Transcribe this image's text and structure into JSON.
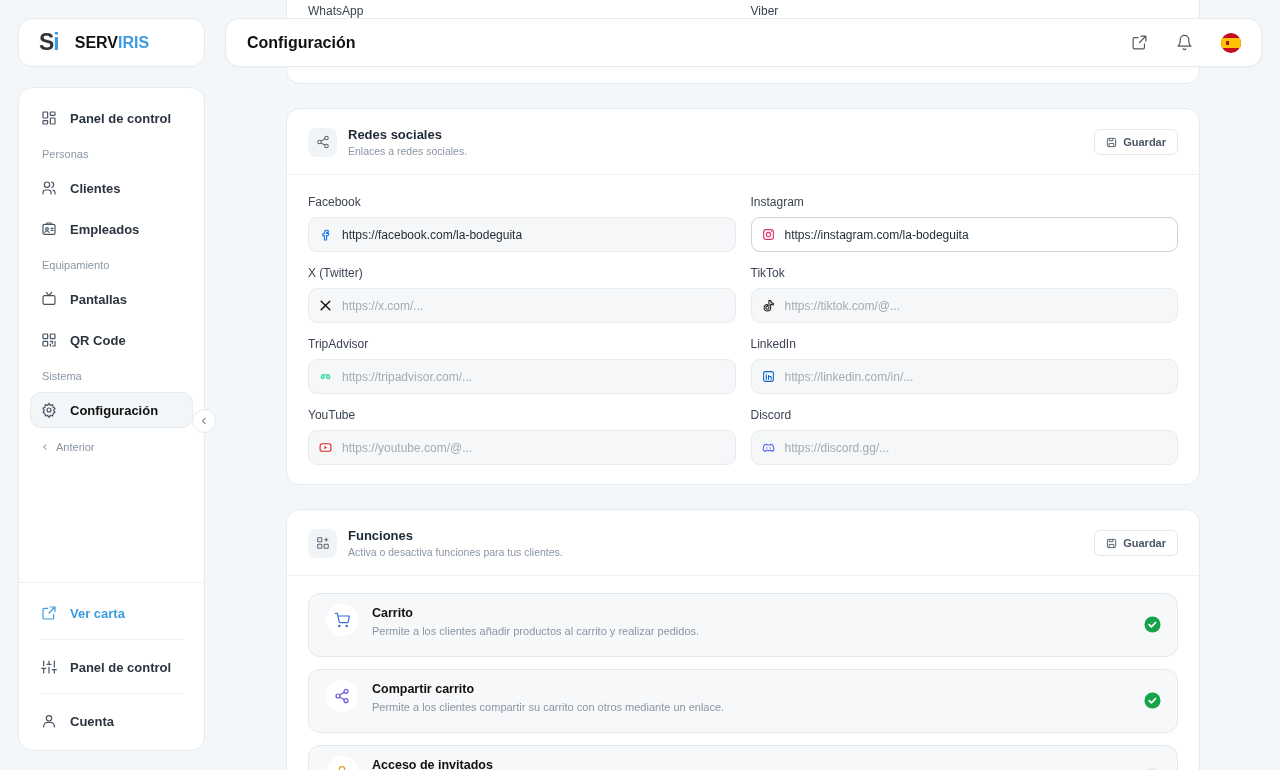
{
  "brand": {
    "mark": [
      "S",
      "i"
    ],
    "name": [
      "SERV",
      "IRIS"
    ]
  },
  "sidebar": {
    "items": [
      {
        "kind": "item",
        "label": "Panel de control",
        "selected": false
      },
      {
        "kind": "section",
        "label": "Personas"
      },
      {
        "kind": "item",
        "label": "Clientes",
        "selected": false
      },
      {
        "kind": "item",
        "label": "Empleados",
        "selected": false
      },
      {
        "kind": "section",
        "label": "Equipamiento"
      },
      {
        "kind": "item",
        "label": "Pantallas",
        "selected": false
      },
      {
        "kind": "item",
        "label": "QR Code",
        "selected": false
      },
      {
        "kind": "section",
        "label": "Sistema"
      },
      {
        "kind": "item",
        "label": "Configuración",
        "selected": true
      }
    ],
    "back": "Anterior",
    "bottom_items": [
      {
        "kind": "link",
        "label": "Ver carta"
      },
      {
        "kind": "item",
        "label": "Panel de control"
      },
      {
        "kind": "item",
        "label": "Cuenta"
      }
    ]
  },
  "header": {
    "title": "Configuración"
  },
  "contact_card": {
    "labels": [
      "WhatsApp",
      "Viber"
    ]
  },
  "social": {
    "title": "Redes sociales",
    "subtitle": "Enlaces a redes sociales.",
    "save": "Guardar",
    "fields": [
      {
        "label": "Facebook",
        "value": "https://facebook.com/la-bodeguita",
        "focused": false
      },
      {
        "label": "Instagram",
        "value": "https://instagram.com/la-bodeguita",
        "focused": true
      },
      {
        "label": "X (Twitter)",
        "placeholder": "https://x.com/...",
        "focused": false
      },
      {
        "label": "TikTok",
        "placeholder": "https://tiktok.com/@...",
        "focused": false
      },
      {
        "label": "TripAdvisor",
        "placeholder": "https://tripadvisor.com/...",
        "focused": false
      },
      {
        "label": "LinkedIn",
        "placeholder": "https://linkedin.com/in/...",
        "focused": false
      },
      {
        "label": "YouTube",
        "placeholder": "https://youtube.com/@...",
        "focused": false
      },
      {
        "label": "Discord",
        "placeholder": "https://discord.gg/...",
        "focused": false
      }
    ]
  },
  "features": {
    "title": "Funciones",
    "subtitle": "Activa o desactiva funciones para tus clientes.",
    "save": "Guardar",
    "items": [
      {
        "title": "Carrito",
        "description": "Permite a los clientes añadir productos al carrito y realizar pedidos.",
        "checked": true
      },
      {
        "title": "Compartir carrito",
        "description": "Permite a los clientes compartir su carrito con otros mediante un enlace.",
        "checked": true
      },
      {
        "title": "Acceso de invitados",
        "checked": false
      }
    ]
  }
}
